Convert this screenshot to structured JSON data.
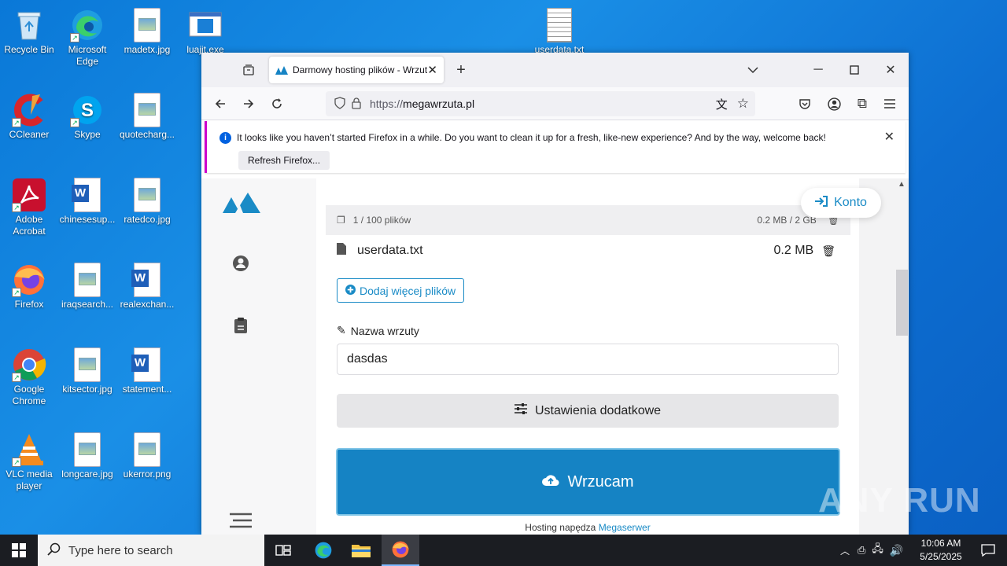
{
  "desktop": {
    "icons": [
      {
        "label": "Recycle Bin"
      },
      {
        "label": "Microsoft Edge"
      },
      {
        "label": "madetx.jpg"
      },
      {
        "label": "luajit.exe"
      },
      {
        "label": "userdata.txt"
      },
      {
        "label": "CCleaner"
      },
      {
        "label": "Skype"
      },
      {
        "label": "quotecharg..."
      },
      {
        "label": "Adobe Acrobat"
      },
      {
        "label": "chinesesup..."
      },
      {
        "label": "ratedco.jpg"
      },
      {
        "label": "Firefox"
      },
      {
        "label": "iraqsearch..."
      },
      {
        "label": "realexchan..."
      },
      {
        "label": "Google Chrome"
      },
      {
        "label": "kitsector.jpg"
      },
      {
        "label": "statement..."
      },
      {
        "label": "VLC media player"
      },
      {
        "label": "longcare.jpg"
      },
      {
        "label": "ukerror.png"
      }
    ]
  },
  "browser": {
    "tab_title": "Darmowy hosting plików - Wrzuta",
    "url_scheme": "https://",
    "url_host": "megawrzuta.pl",
    "notification": {
      "message": "It looks like you haven’t started Firefox in a while. Do you want to clean it up for a fresh, like-new experience? And by the way, welcome back!",
      "button": "Refresh Firefox..."
    }
  },
  "page": {
    "konto": "Konto",
    "files_count": "1 / 100 plików",
    "files_size": "0.2 MB / 2 GB",
    "file_name": "userdata.txt",
    "file_size": "0.2 MB",
    "add_more": "Dodaj więcej plików",
    "name_label": "Nazwa wrzuty",
    "name_value": "dasdas",
    "settings_button": "Ustawienia dodatkowe",
    "upload_button": "Wrzucam",
    "footer_text": "Hosting napędza ",
    "footer_link": "Megaserwer"
  },
  "watermark": "ANY RUN",
  "taskbar": {
    "search_placeholder": "Type here to search",
    "time": "10:06 AM",
    "date": "5/25/2025"
  },
  "colors": {
    "accent": "#1583c4",
    "desktop": "#0a78d7",
    "taskbar": "#1b1d22"
  }
}
